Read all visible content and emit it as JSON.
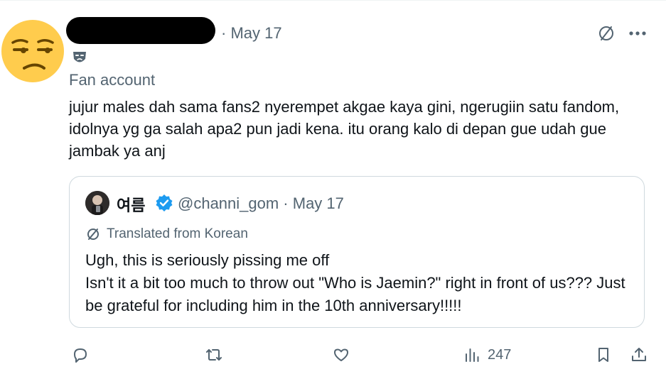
{
  "tweet": {
    "date": "· May 17",
    "label": "Fan account",
    "text": "jujur males dah sama fans2 nyerempet akgae kaya gini, ngerugiin satu fandom, idolnya yg ga salah apa2 pun jadi kena. itu orang kalo di depan gue udah gue jambak ya anj"
  },
  "quote": {
    "name": "여름",
    "handle": "@channi_gom · May 17",
    "translated": "Translated from Korean",
    "line1": "Ugh, this is seriously pissing me off",
    "line2": "Isn't it a bit too much to throw out \"Who is Jaemin?\" right in front of us??? Just be grateful for including him in the 10th anniversary!!!!!"
  },
  "actions": {
    "views": "247"
  },
  "colors": {
    "text": "#0f1419",
    "muted": "#536471",
    "border": "#cfd9de",
    "verified": "#1d9bf0",
    "emoji": "#ffcc4d"
  },
  "icons": [
    "unamused-emoji-avatar",
    "no-translate-icon",
    "more-icon",
    "mask-icon",
    "verified-icon",
    "translate-icon",
    "reply-icon",
    "retweet-icon",
    "like-icon",
    "views-icon",
    "bookmark-icon",
    "share-icon"
  ]
}
